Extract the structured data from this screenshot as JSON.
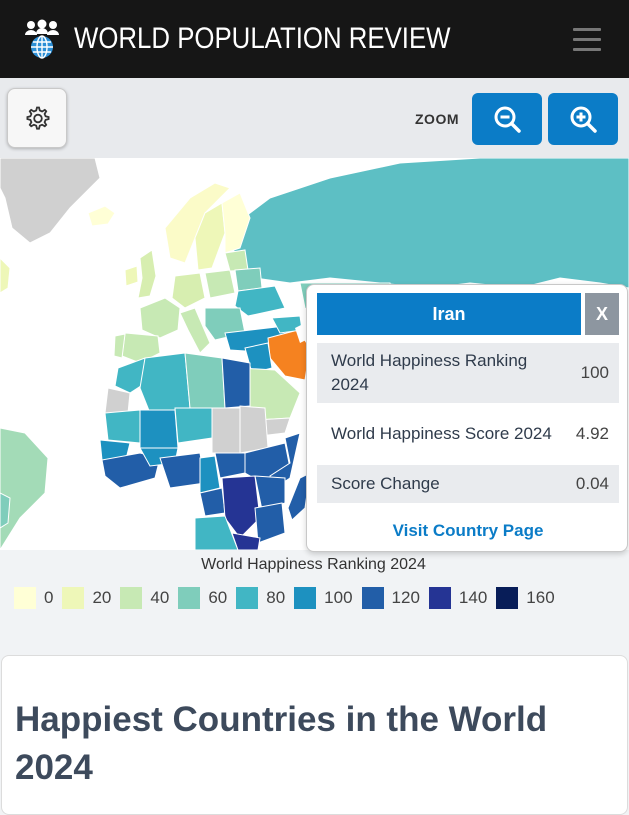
{
  "header": {
    "brand": "WORLD POPULATION REVIEW",
    "logo_icon": "people-globe-icon",
    "menu_icon": "hamburger-icon"
  },
  "toolbar": {
    "settings_icon": "gear-icon",
    "zoom_label": "ZOOM",
    "zoom_out_icon": "zoom-out-icon",
    "zoom_in_icon": "zoom-in-icon"
  },
  "map": {
    "highlighted_country_color": "#f58220",
    "popup": {
      "country": "Iran",
      "close_label": "X",
      "rows": [
        {
          "label": "World Happiness Ranking 2024",
          "value": "100"
        },
        {
          "label": "World Happiness Score 2024",
          "value": "4.92"
        },
        {
          "label": "Score Change",
          "value": "0.04"
        }
      ],
      "visit_label": "Visit Country Page"
    },
    "legend": {
      "title": "World Happiness Ranking 2024",
      "items": [
        {
          "label": "0",
          "color": "#ffffd6"
        },
        {
          "label": "20",
          "color": "#eef7b8"
        },
        {
          "label": "40",
          "color": "#c7e9b4"
        },
        {
          "label": "60",
          "color": "#7fcdbb"
        },
        {
          "label": "80",
          "color": "#41b6c4"
        },
        {
          "label": "100",
          "color": "#1d91c0"
        },
        {
          "label": "120",
          "color": "#225ea8"
        },
        {
          "label": "140",
          "color": "#253494"
        },
        {
          "label": "160",
          "color": "#081d58"
        }
      ]
    }
  },
  "article": {
    "title": "Happiest Countries in the World 2024"
  }
}
